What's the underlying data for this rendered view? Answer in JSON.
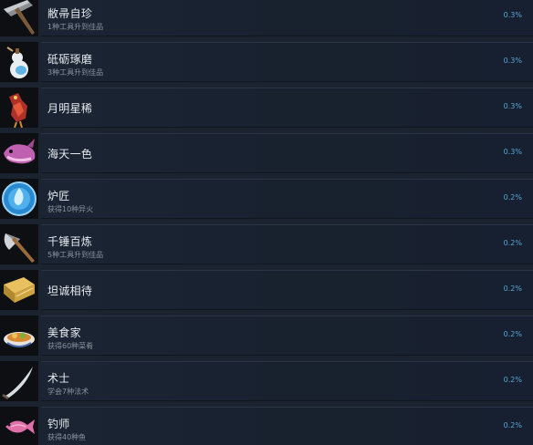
{
  "achievements": [
    {
      "title": "敝帚自珍",
      "desc": "1种工具升到佳品",
      "percent": "0.3%",
      "icon": "pickaxe-icon"
    },
    {
      "title": "砥砺琢磨",
      "desc": "3种工具升到佳品",
      "percent": "0.3%",
      "icon": "gourd-icon"
    },
    {
      "title": "月明星稀",
      "desc": "",
      "percent": "0.3%",
      "icon": "red-bird-icon"
    },
    {
      "title": "海天一色",
      "desc": "",
      "percent": "0.3%",
      "icon": "whale-icon"
    },
    {
      "title": "炉匠",
      "desc": "获得10种异火",
      "percent": "0.2%",
      "icon": "blue-flame-icon"
    },
    {
      "title": "千锤百炼",
      "desc": "5种工具升到佳品",
      "percent": "0.2%",
      "icon": "axe-icon"
    },
    {
      "title": "坦诚相待",
      "desc": "",
      "percent": "0.2%",
      "icon": "gold-book-icon"
    },
    {
      "title": "美食家",
      "desc": "获得60种菜肴",
      "percent": "0.2%",
      "icon": "food-bowl-icon"
    },
    {
      "title": "术士",
      "desc": "学会7种法术",
      "percent": "0.2%",
      "icon": "blade-icon"
    },
    {
      "title": "钓师",
      "desc": "获得40种鱼",
      "percent": "0.2%",
      "icon": "fish-icon"
    }
  ]
}
